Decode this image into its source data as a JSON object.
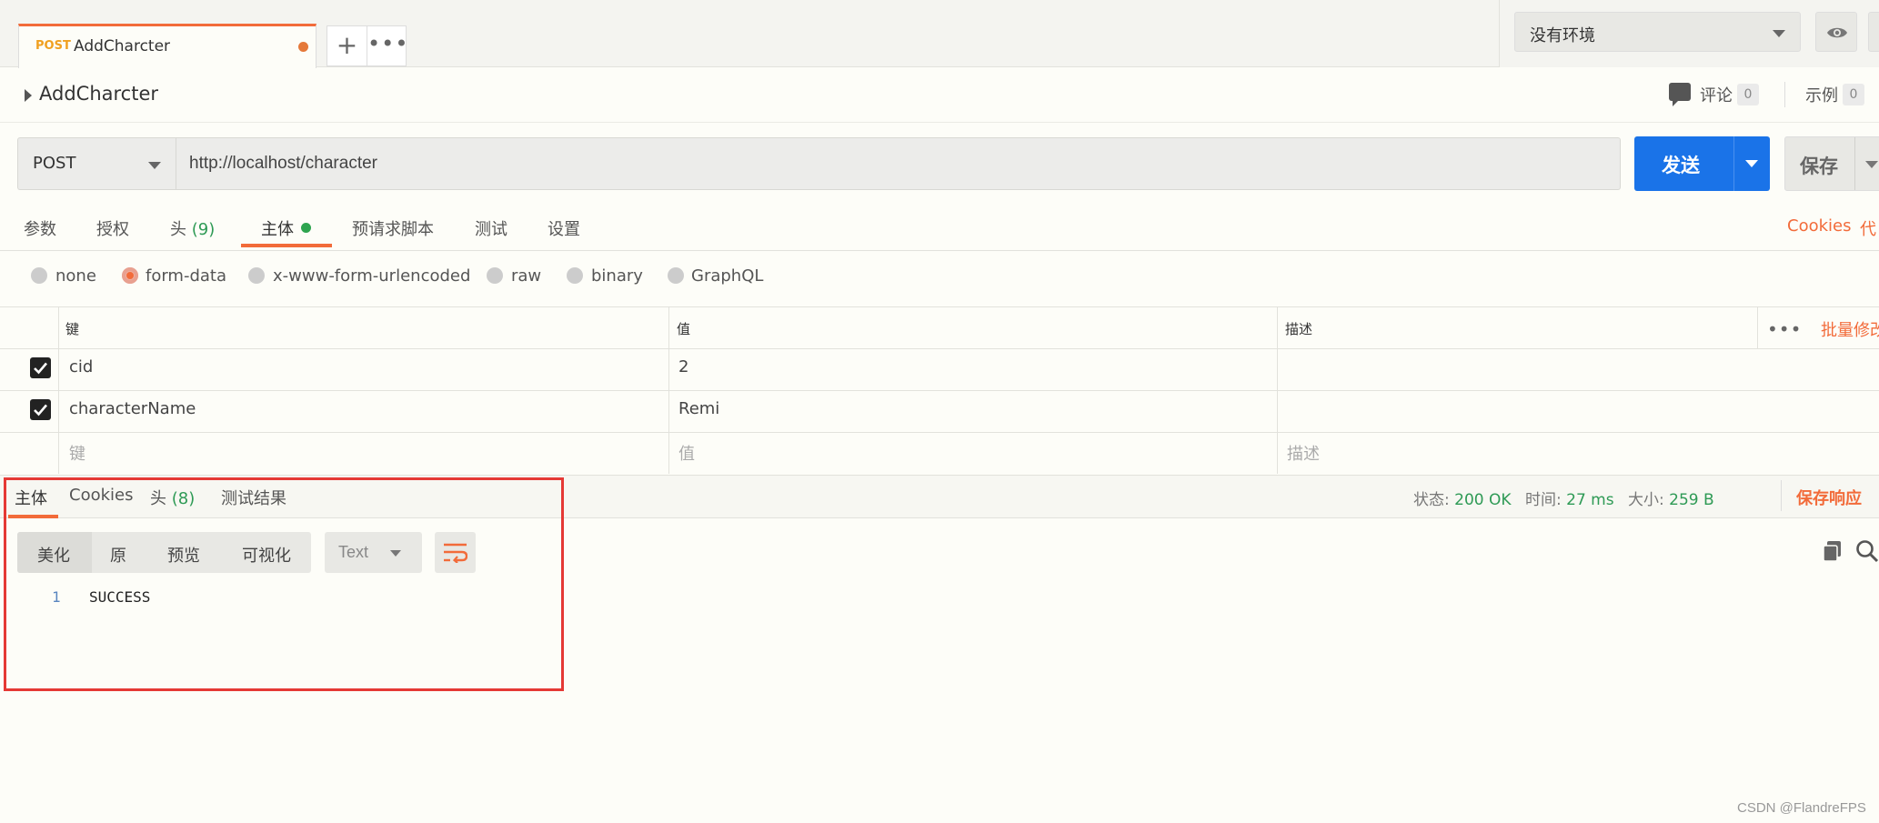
{
  "tabs": {
    "active": {
      "method": "POST",
      "name": "AddCharcter"
    }
  },
  "environment": {
    "selected": "没有环境"
  },
  "request": {
    "name": "AddCharcter",
    "comments": {
      "label": "评论",
      "count": "0"
    },
    "examples": {
      "label": "示例",
      "count": "0"
    },
    "method": "POST",
    "url": "http://localhost/character",
    "send_label": "发送",
    "save_label": "保存"
  },
  "request_tabs": {
    "params": "参数",
    "auth": "授权",
    "headers": {
      "label": "头",
      "count": "(9)"
    },
    "body": "主体",
    "prerequest": "预请求脚本",
    "tests": "测试",
    "settings": "设置",
    "cookies": "Cookies",
    "code": "代"
  },
  "body_types": [
    "none",
    "form-data",
    "x-www-form-urlencoded",
    "raw",
    "binary",
    "GraphQL"
  ],
  "body_type_selected": "form-data",
  "form_table": {
    "headers": {
      "key": "键",
      "value": "值",
      "description": "描述"
    },
    "bulk_edit": "批量修改",
    "rows": [
      {
        "checked": true,
        "key": "cid",
        "value": "2",
        "description": ""
      },
      {
        "checked": true,
        "key": "characterName",
        "value": "Remi",
        "description": ""
      }
    ],
    "placeholder": {
      "key": "键",
      "value": "值",
      "description": "描述"
    }
  },
  "response_tabs": {
    "body": "主体",
    "cookies": "Cookies",
    "headers": {
      "label": "头",
      "count": "(8)"
    },
    "test_results": "测试结果"
  },
  "response_status": {
    "status_label": "状态:",
    "status_value": "200 OK",
    "time_label": "时间:",
    "time_value": "27 ms",
    "size_label": "大小:",
    "size_value": "259 B",
    "save_response": "保存响应"
  },
  "response_view": {
    "modes": [
      "美化",
      "原",
      "预览",
      "可视化"
    ],
    "format": "Text"
  },
  "response_body": {
    "line_number": "1",
    "text": "SUCCESS"
  },
  "watermark": "CSDN @FlandreFPS",
  "colors": {
    "accent": "#f26b3a",
    "primary": "#1a73e8",
    "success": "#2e9a55",
    "highlight": "#e53935"
  }
}
